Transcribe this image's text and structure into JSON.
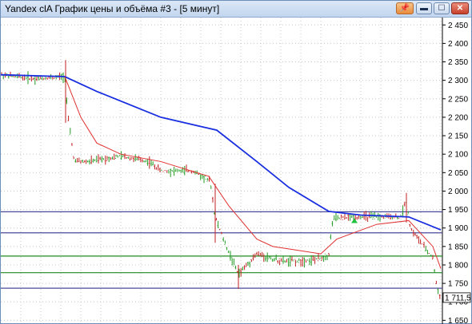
{
  "window": {
    "title": "Yandex clA График цены и объёма #3 - [5 минут]",
    "buttons": {
      "pin": "📌",
      "minimize": "▬",
      "maximize": "☐",
      "close": "✕"
    }
  },
  "chart_data": {
    "type": "candlestick",
    "y_ticks": [
      "2 450",
      "2 400",
      "2 350",
      "2 300",
      "2 250",
      "2 200",
      "2 150",
      "2 100",
      "2 050",
      "2 000",
      "1 950",
      "1 900",
      "1 850",
      "1 800",
      "1 750",
      "1 700",
      "1 650"
    ],
    "ylim": [
      1640,
      2470
    ],
    "current_price_label": "1 711,5",
    "horizontal_levels": [
      {
        "value": 1944,
        "color": "#4a4a9a"
      },
      {
        "value": 1887,
        "color": "#4a4a9a"
      },
      {
        "value": 1824,
        "color": "#1f8a1f"
      },
      {
        "value": 1779,
        "color": "#1f8a1f"
      },
      {
        "value": 1737,
        "color": "#4a4a9a"
      }
    ],
    "moving_averages": [
      {
        "color": "#1a2fe0",
        "points": [
          [
            0,
            2315
          ],
          [
            80,
            2310
          ],
          [
            120,
            2270
          ],
          [
            200,
            2200
          ],
          [
            270,
            2165
          ],
          [
            320,
            2080
          ],
          [
            360,
            2010
          ],
          [
            410,
            1945
          ],
          [
            450,
            1935
          ],
          [
            510,
            1930
          ],
          [
            550,
            1895
          ]
        ]
      },
      {
        "color": "#e03030",
        "points": [
          [
            80,
            2310
          ],
          [
            100,
            2200
          ],
          [
            120,
            2130
          ],
          [
            150,
            2100
          ],
          [
            200,
            2080
          ],
          [
            260,
            2040
          ],
          [
            285,
            1960
          ],
          [
            320,
            1870
          ],
          [
            340,
            1850
          ],
          [
            400,
            1830
          ],
          [
            420,
            1870
          ],
          [
            470,
            1910
          ],
          [
            510,
            1920
          ],
          [
            540,
            1850
          ],
          [
            550,
            1790
          ]
        ]
      }
    ],
    "price_path": [
      [
        0,
        2315
      ],
      [
        40,
        2305
      ],
      [
        70,
        2308
      ],
      [
        80,
        2312
      ],
      [
        84,
        2200
      ],
      [
        92,
        2080
      ],
      [
        110,
        2080
      ],
      [
        150,
        2095
      ],
      [
        185,
        2080
      ],
      [
        200,
        2055
      ],
      [
        240,
        2055
      ],
      [
        262,
        2025
      ],
      [
        268,
        1930
      ],
      [
        280,
        1860
      ],
      [
        297,
        1775
      ],
      [
        320,
        1830
      ],
      [
        350,
        1810
      ],
      [
        370,
        1810
      ],
      [
        395,
        1815
      ],
      [
        410,
        1825
      ],
      [
        415,
        1925
      ],
      [
        440,
        1930
      ],
      [
        500,
        1930
      ],
      [
        507,
        1975
      ],
      [
        512,
        1900
      ],
      [
        530,
        1845
      ],
      [
        540,
        1820
      ],
      [
        545,
        1740
      ],
      [
        550,
        1712
      ]
    ]
  }
}
